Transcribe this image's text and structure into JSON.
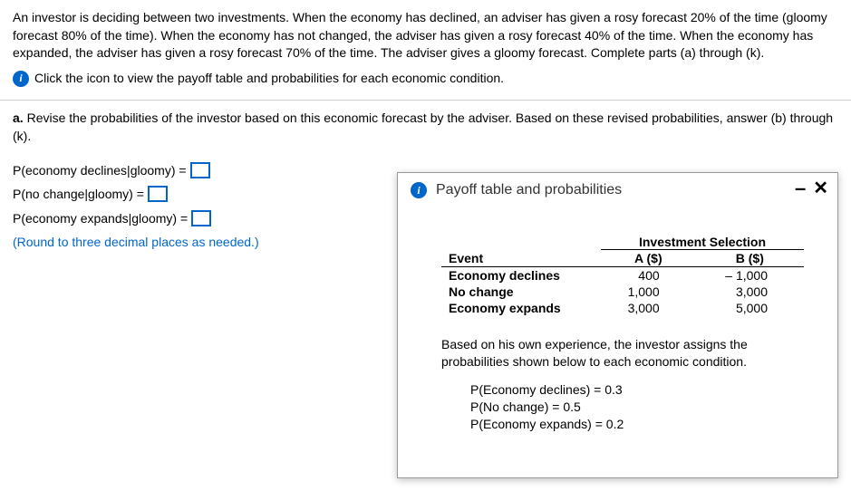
{
  "question": {
    "text": "An investor is deciding between two investments. When the economy has declined, an adviser has given a rosy forecast 20% of the time (gloomy forecast 80% of the time). When the economy has not changed, the adviser has given a rosy forecast 40% of the time. When the economy has expanded, the adviser has given a rosy forecast 70% of the time. The adviser gives a gloomy forecast. Complete parts (a) through (k).",
    "info_line": "Click the icon to view the payoff table and probabilities for each economic condition."
  },
  "part_a": {
    "label": "a.",
    "text": "Revise the probabilities of the investor based on this economic forecast by the adviser. Based on these revised probabilities, answer (b) through (k)."
  },
  "answers": {
    "row1": "P(economy declines|gloomy) =",
    "row2": "P(no change|gloomy) =",
    "row3": "P(economy expands|gloomy) =",
    "rounding": "(Round to three decimal places as needed.)"
  },
  "popup": {
    "title": "Payoff table and probabilities",
    "table": {
      "spanner": "Investment Selection",
      "head_event": "Event",
      "head_a": "A ($)",
      "head_b": "B ($)",
      "rows": [
        {
          "event": "Economy declines",
          "a": "400",
          "b": "– 1,000"
        },
        {
          "event": "No change",
          "a": "1,000",
          "b": "3,000"
        },
        {
          "event": "Economy expands",
          "a": "3,000",
          "b": "5,000"
        }
      ]
    },
    "note": "Based on his own experience, the investor assigns the probabilities shown below to each economic condition.",
    "probs": {
      "p1": "P(Economy declines) = 0.3",
      "p2": "P(No change) = 0.5",
      "p3": "P(Economy expands) = 0.2"
    }
  }
}
